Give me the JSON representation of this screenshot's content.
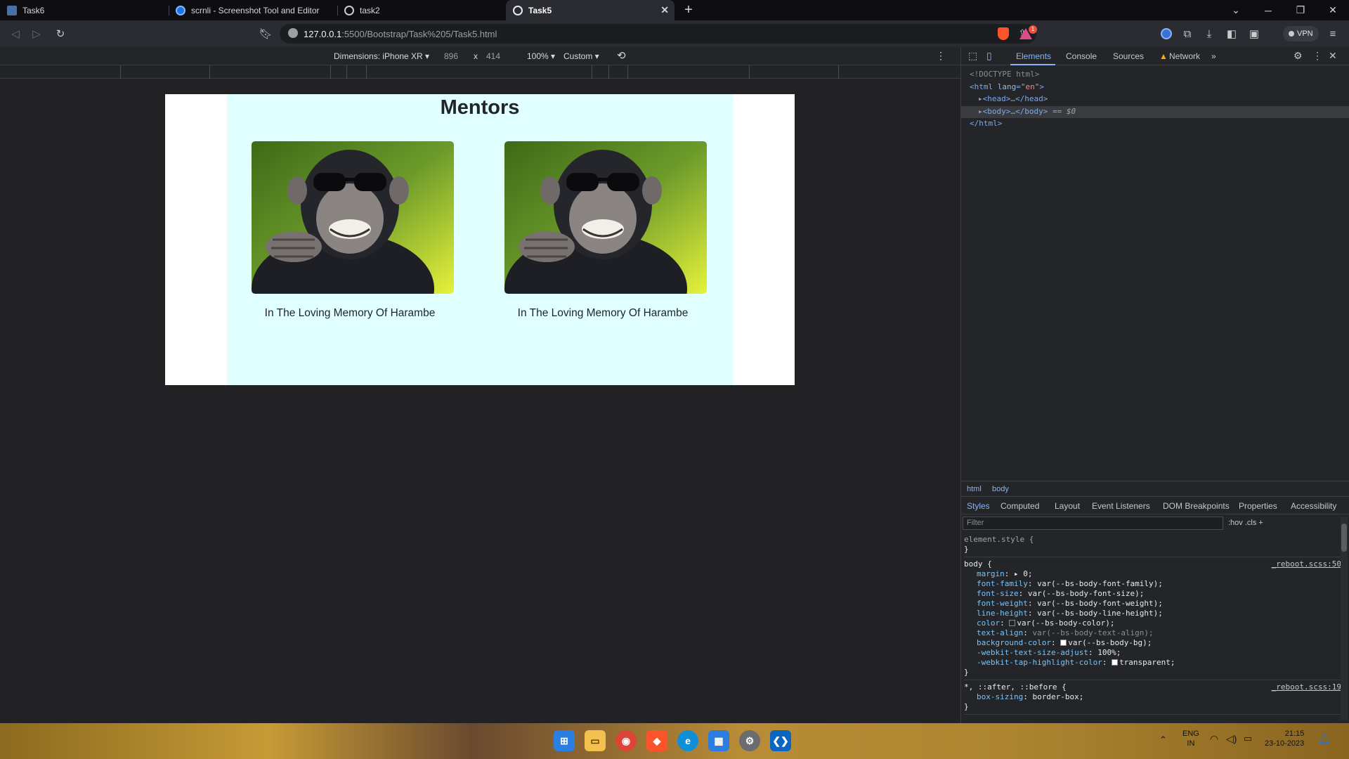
{
  "browser": {
    "tabs": [
      {
        "title": "Task6",
        "active": false
      },
      {
        "title": "scrnli - Screenshot Tool and Editor",
        "active": false
      },
      {
        "title": "task2",
        "active": false
      },
      {
        "title": "Task5",
        "active": true
      }
    ],
    "new_tab": "+",
    "url_host": "127.0.0.1",
    "url_path": ":5500/Bootstrap/Task%205/Task5.html",
    "vpn_label": "VPN",
    "notification_count": "1"
  },
  "device_toolbar": {
    "dimensions_label": "Dimensions: iPhone XR ▾",
    "width": "896",
    "times": "x",
    "height": "414",
    "zoom": "100% ▾",
    "throttle": "Custom ▾"
  },
  "page": {
    "heading": "Mentors",
    "cards": [
      {
        "caption": "In The Loving Memory Of Harambe"
      },
      {
        "caption": "In The Loving Memory Of Harambe"
      }
    ],
    "colors": {
      "container_bg": "#e0ffff",
      "page_bg": "#ffffff"
    }
  },
  "devtools": {
    "tabs": [
      "Elements",
      "Console",
      "Sources",
      "Network"
    ],
    "active_tab": "Elements",
    "dom": {
      "doctype": "<!DOCTYPE html>",
      "html_open_tag": "<html ",
      "html_attr": "lang",
      "html_attr_val": "\"en\"",
      "head": "<head>",
      "head_close": "</head>",
      "body": "<body>",
      "body_close": "</body>",
      "body_marker": "== $0",
      "html_close": "</html>",
      "ellipsis": "…"
    },
    "breadcrumb": [
      "html",
      "body"
    ],
    "styles_tabs": [
      "Styles",
      "Computed",
      "Layout",
      "Event Listeners",
      "DOM Breakpoints",
      "Properties",
      "Accessibility"
    ],
    "filter_placeholder": "Filter",
    "filter_tools": ":hov  .cls  +",
    "rules": {
      "element_style": "element.style {",
      "body_selector": "body {",
      "body_source": "_reboot.scss:50",
      "body_props": [
        {
          "name": "margin",
          "value": "▸ 0;"
        },
        {
          "name": "font-family",
          "value": "var(--bs-body-font-family);"
        },
        {
          "name": "font-size",
          "value": "var(--bs-body-font-size);"
        },
        {
          "name": "font-weight",
          "value": "var(--bs-body-font-weight);"
        },
        {
          "name": "line-height",
          "value": "var(--bs-body-line-height);"
        },
        {
          "name": "color",
          "value": "var(--bs-body-color);"
        },
        {
          "name": "text-align",
          "value": "var(--bs-body-text-align);"
        },
        {
          "name": "background-color",
          "value": "var(--bs-body-bg);"
        },
        {
          "name": "-webkit-text-size-adjust",
          "value": "100%;"
        },
        {
          "name": "-webkit-tap-highlight-color",
          "value": "transparent;"
        }
      ],
      "universal_selector": "*, ::after, ::before {",
      "universal_source": "_reboot.scss:19",
      "universal_prop_name": "box-sizing",
      "universal_prop_value": "border-box;",
      "close_brace": "}"
    }
  },
  "taskbar": {
    "lang_top": "ENG",
    "lang_bottom": "IN",
    "time": "21:15",
    "date": "23-10-2023"
  }
}
